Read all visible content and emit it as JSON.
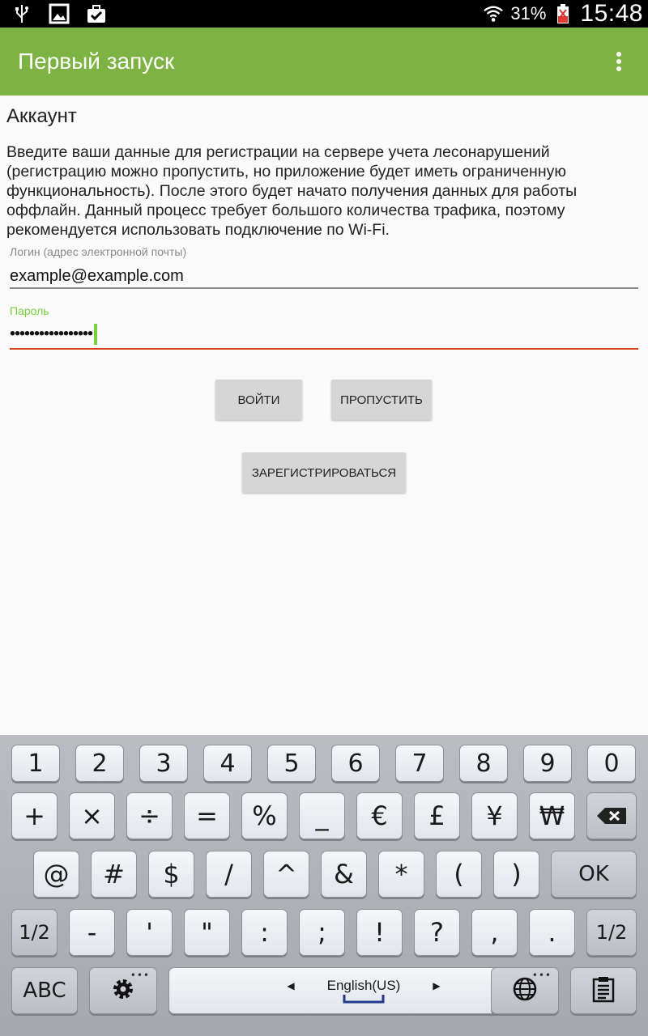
{
  "status_bar": {
    "icons": [
      "usb-icon",
      "image-icon",
      "briefcase-icon",
      "wifi-icon",
      "battery-icon"
    ],
    "battery": "31%",
    "time": "15:48"
  },
  "app_bar": {
    "title": "Первый запуск",
    "menu_icon": "more-vert-icon"
  },
  "content": {
    "section_title": "Аккаунт",
    "description": "Введите ваши данные для регистрации на сервере учета лесонарушений (регистрацию можно пропустить, но приложение будет иметь ограниченную функциональность). После этого будет начато получения данных для работы оффлайн. Данный процесс требует большого количества трафика, поэтому рекомендуется использовать подключение по Wi-Fi.",
    "login": {
      "label": "Логин (адрес электронной почты)",
      "value": "example@example.com"
    },
    "password": {
      "label": "Пароль",
      "value": "•••••••••••••••••"
    },
    "buttons": {
      "login": "ВОЙТИ",
      "skip": "ПРОПУСТИТЬ",
      "register": "ЗАРЕГИСТРИРОВАТЬСЯ"
    }
  },
  "keyboard": {
    "row1": [
      "1",
      "2",
      "3",
      "4",
      "5",
      "6",
      "7",
      "8",
      "9",
      "0"
    ],
    "row2": [
      "+",
      "×",
      "÷",
      "=",
      "%",
      "_",
      "€",
      "£",
      "¥",
      "₩"
    ],
    "row3": [
      "@",
      "#",
      "$",
      "/",
      "^",
      "&",
      "*",
      "(",
      ")",
      "OK"
    ],
    "row4": [
      "1/2",
      "-",
      "'",
      "\"",
      ":",
      ";",
      "!",
      "?",
      ",",
      ".",
      "1/2"
    ],
    "row5": {
      "abc": "ABC",
      "language": "English(US)"
    },
    "colors": {
      "background": "#b1b3b8",
      "key": "#eef0f3"
    }
  },
  "colors": {
    "app_bar": "#7cb342",
    "accent": "#76d13b",
    "error_line": "#d84315"
  }
}
